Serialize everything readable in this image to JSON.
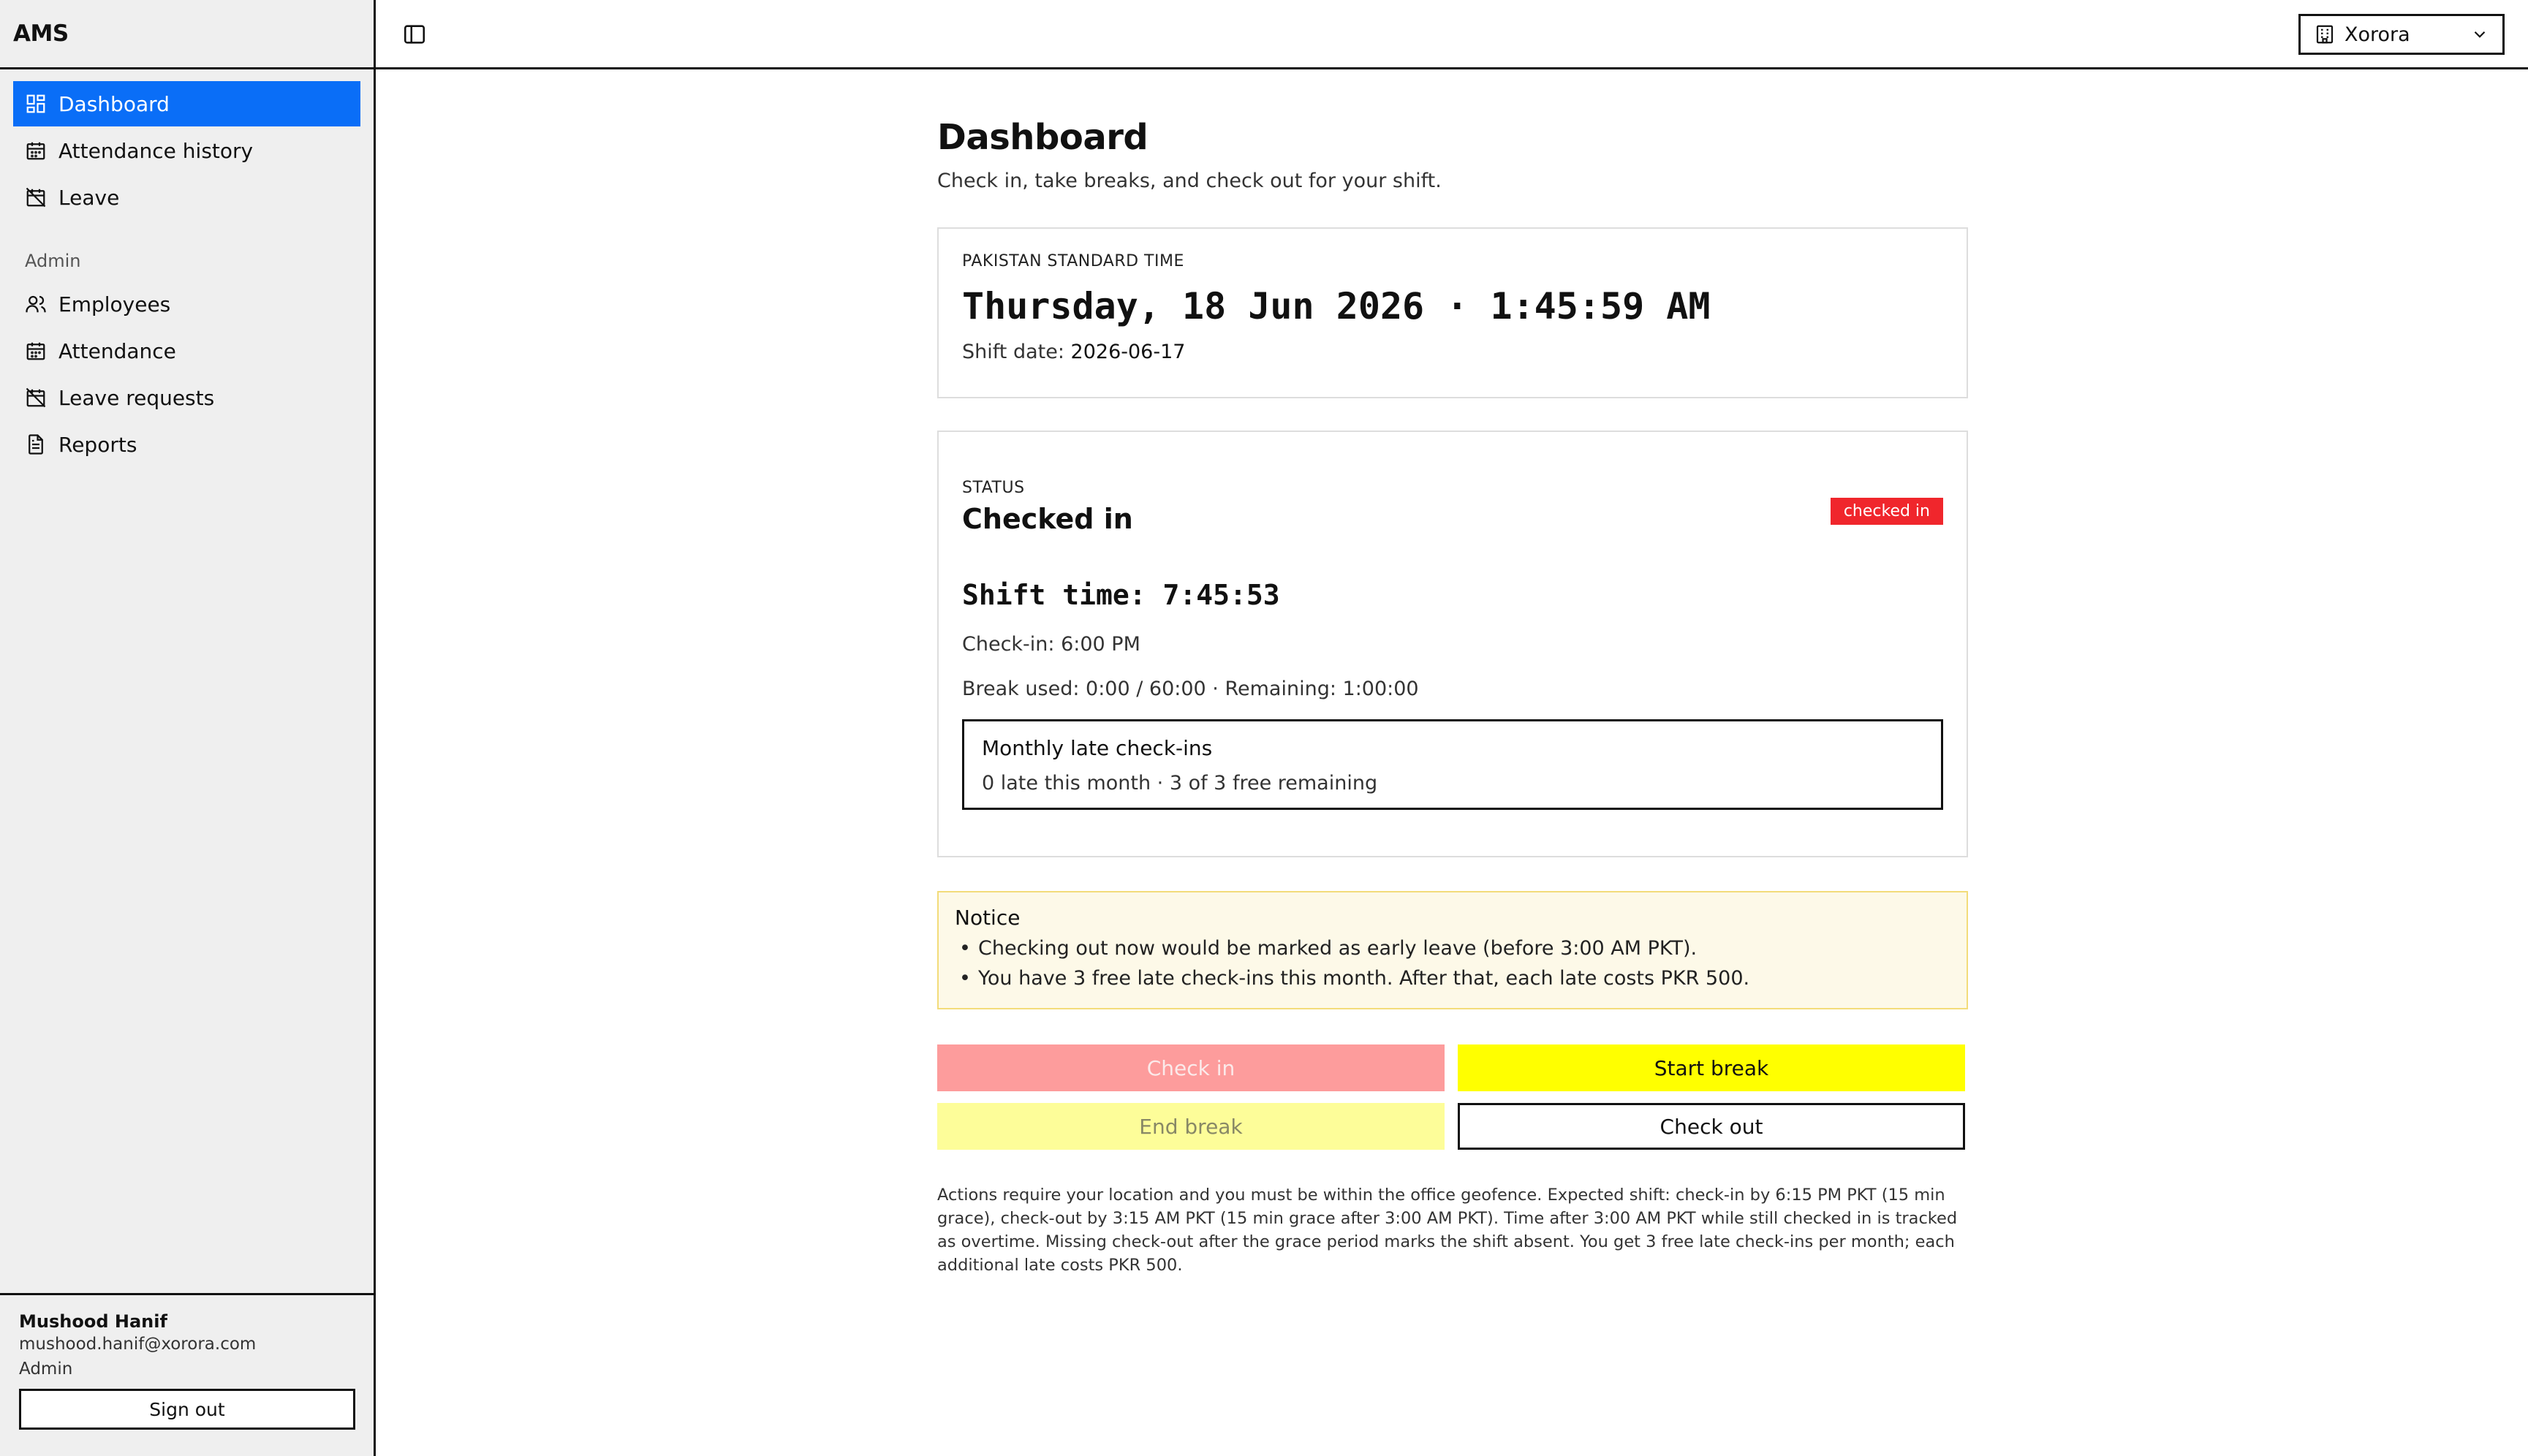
{
  "app": {
    "brand": "AMS"
  },
  "sidebar": {
    "items": [
      {
        "label": "Dashboard",
        "icon": "dashboard-icon",
        "active": true
      },
      {
        "label": "Attendance history",
        "icon": "calendar-icon"
      },
      {
        "label": "Leave",
        "icon": "calendar-off-icon"
      }
    ],
    "admin_section": "Admin",
    "admin_items": [
      {
        "label": "Employees",
        "icon": "users-icon"
      },
      {
        "label": "Attendance",
        "icon": "calendar-icon"
      },
      {
        "label": "Leave requests",
        "icon": "calendar-off-icon"
      },
      {
        "label": "Reports",
        "icon": "file-text-icon"
      }
    ]
  },
  "user": {
    "name": "Mushood Hanif",
    "email": "mushood.hanif@xorora.com",
    "role": "Admin",
    "signout_label": "Sign out"
  },
  "topbar": {
    "org": "Xorora"
  },
  "page": {
    "title": "Dashboard",
    "subtitle": "Check in, take breaks, and check out for your shift."
  },
  "clock": {
    "zone_label": "PAKISTAN STANDARD TIME",
    "datetime": "Thursday, 18 Jun 2026 · 1:45:59 AM",
    "shift_date_label": "Shift date:",
    "shift_date": "2026-06-17"
  },
  "status": {
    "eyebrow": "STATUS",
    "title": "Checked in",
    "badge": "checked in",
    "badge_color": "#f0262c",
    "shift_time": "Shift time: 7:45:53",
    "check_in": "Check-in: 6:00 PM",
    "break_line": "Break used: 0:00 / 60:00 · Remaining: 1:00:00",
    "late_title": "Monthly late check-ins",
    "late_text": "0 late this month · 3 of 3 free remaining"
  },
  "notice": {
    "title": "Notice",
    "items": [
      "Checking out now would be marked as early leave (before 3:00 AM PKT).",
      "You have 3 free late check-ins this month. After that, each late costs PKR 500."
    ]
  },
  "actions": {
    "check_in": "Check in",
    "start_break": "Start break",
    "end_break": "End break",
    "check_out": "Check out"
  },
  "footnote": "Actions require your location and you must be within the office geofence. Expected shift: check-in by 6:15 PM PKT (15 min grace), check-out by 3:15 AM PKT (15 min grace after 3:00 AM PKT). Time after 3:00 AM PKT while still checked in is tracked as overtime. Missing check-out after the grace period marks the shift absent. You get 3 free late check-ins per month; each additional late costs PKR 500.",
  "colors": {
    "accent": "#0a6ef7",
    "check_in_button": "#fd9c9c",
    "start_break_button": "#ffff00",
    "end_break_button": "#fdfd99"
  }
}
